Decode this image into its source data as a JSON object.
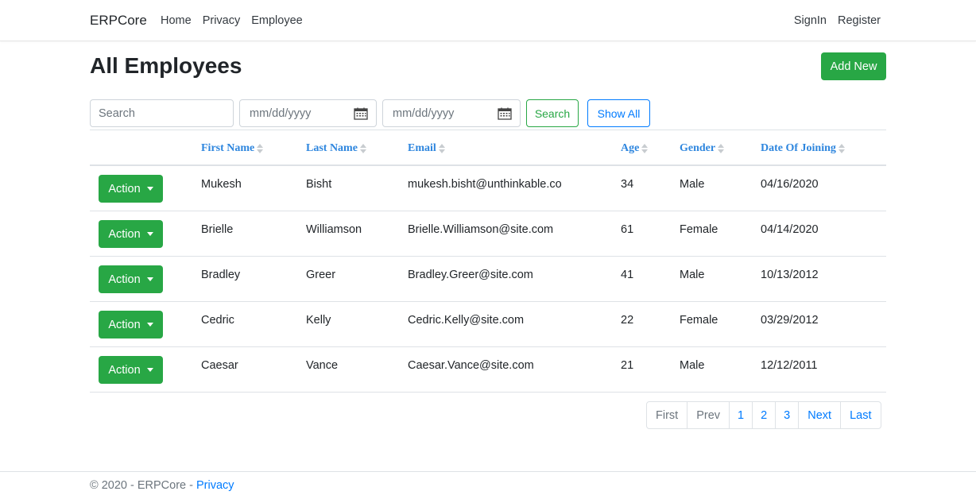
{
  "nav": {
    "brand": "ERPCore",
    "links": [
      "Home",
      "Privacy",
      "Employee"
    ],
    "right_links": [
      "SignIn",
      "Register"
    ]
  },
  "page": {
    "title": "All Employees",
    "add_button": "Add New"
  },
  "filters": {
    "search_placeholder": "Search",
    "date_from": "mm/dd/yyyy",
    "date_to": "mm/dd/yyyy",
    "search_button": "Search",
    "show_all_button": "Show All"
  },
  "table": {
    "columns": [
      "First Name",
      "Last Name",
      "Email",
      "Age",
      "Gender",
      "Date Of Joining"
    ],
    "action_label": "Action",
    "rows": [
      {
        "first": "Mukesh",
        "last": "Bisht",
        "email": "mukesh.bisht@unthinkable.co",
        "age": "34",
        "gender": "Male",
        "doj": "04/16/2020"
      },
      {
        "first": "Brielle",
        "last": "Williamson",
        "email": "Brielle.Williamson@site.com",
        "age": "61",
        "gender": "Female",
        "doj": "04/14/2020"
      },
      {
        "first": "Bradley",
        "last": "Greer",
        "email": "Bradley.Greer@site.com",
        "age": "41",
        "gender": "Male",
        "doj": "10/13/2012"
      },
      {
        "first": "Cedric",
        "last": "Kelly",
        "email": "Cedric.Kelly@site.com",
        "age": "22",
        "gender": "Female",
        "doj": "03/29/2012"
      },
      {
        "first": "Caesar",
        "last": "Vance",
        "email": "Caesar.Vance@site.com",
        "age": "21",
        "gender": "Male",
        "doj": "12/12/2011"
      }
    ]
  },
  "pagination": {
    "first": "First",
    "prev": "Prev",
    "pages": [
      "1",
      "2",
      "3"
    ],
    "next": "Next",
    "last": "Last"
  },
  "footer": {
    "text": "© 2020 - ERPCore - ",
    "link": "Privacy"
  },
  "colors": {
    "success": "#28a745",
    "primary": "#007bff",
    "header_link": "#2e86de"
  }
}
